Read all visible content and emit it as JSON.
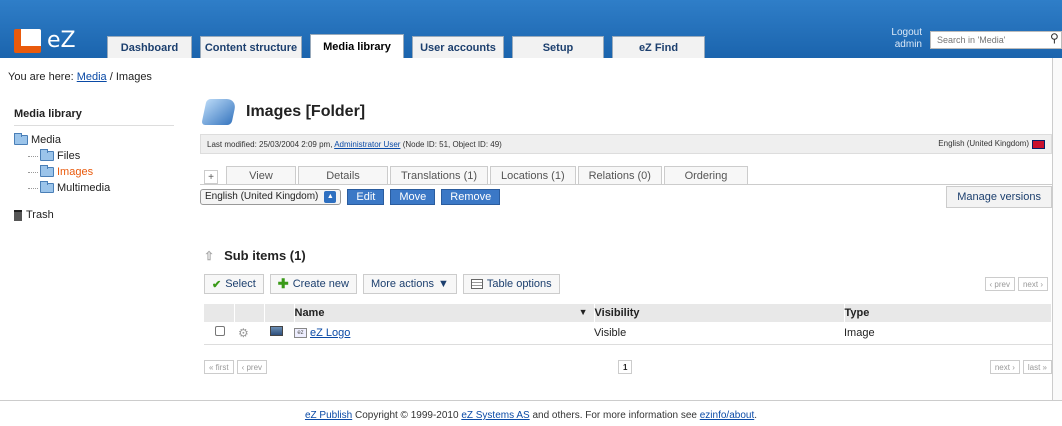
{
  "header": {
    "logo_text": "eZ",
    "tabs": [
      {
        "label": "Dashboard"
      },
      {
        "label": "Content structure"
      },
      {
        "label": "Media library"
      },
      {
        "label": "User accounts"
      },
      {
        "label": "Setup"
      },
      {
        "label": "eZ Find"
      }
    ],
    "logout_label": "Logout",
    "user_label": "admin",
    "search_placeholder": "Search in 'Media'"
  },
  "breadcrumb": {
    "prefix": "You are here:",
    "link": "Media",
    "separator": " / ",
    "current": "Images"
  },
  "sidebar": {
    "title": "Media library",
    "items": [
      {
        "label": "Media"
      },
      {
        "label": "Files"
      },
      {
        "label": "Images"
      },
      {
        "label": "Multimedia"
      }
    ],
    "trash_label": "Trash"
  },
  "main": {
    "title": "Images [Folder]",
    "meta_prefix": "Last modified: 25/03/2004 2:09 pm,",
    "meta_user": "Administrator User",
    "meta_suffix": "(Node ID: 51, Object ID: 49)",
    "language": "English (United Kingdom)",
    "view_tabs": [
      {
        "label": "+"
      },
      {
        "label": "View"
      },
      {
        "label": "Details"
      },
      {
        "label": "Translations (1)"
      },
      {
        "label": "Locations (1)"
      },
      {
        "label": "Relations (0)"
      },
      {
        "label": "Ordering"
      }
    ],
    "lang_select": "English (United Kingdom)",
    "edit_label": "Edit",
    "move_label": "Move",
    "remove_label": "Remove",
    "manage_versions": "Manage versions"
  },
  "sub_items": {
    "title": "Sub items (1)",
    "select_label": "Select",
    "create_label": "Create new",
    "more_actions_label": "More actions",
    "table_options_label": "Table options",
    "prev_label": "‹ prev",
    "next_label": "next ›",
    "first_label": "« first",
    "last_label": "last »",
    "page_number": "1",
    "columns": [
      "Name",
      "Visibility",
      "Type"
    ],
    "rows": [
      {
        "name": "eZ Logo",
        "visibility": "Visible",
        "type": "Image"
      }
    ]
  },
  "footer": {
    "product_link": "eZ Publish",
    "copyright": " Copyright © 1999-2010 ",
    "company_link": "eZ Systems AS",
    "tail": " and others. For more information see ",
    "info_link": "ezinfo/about",
    "end": "."
  }
}
